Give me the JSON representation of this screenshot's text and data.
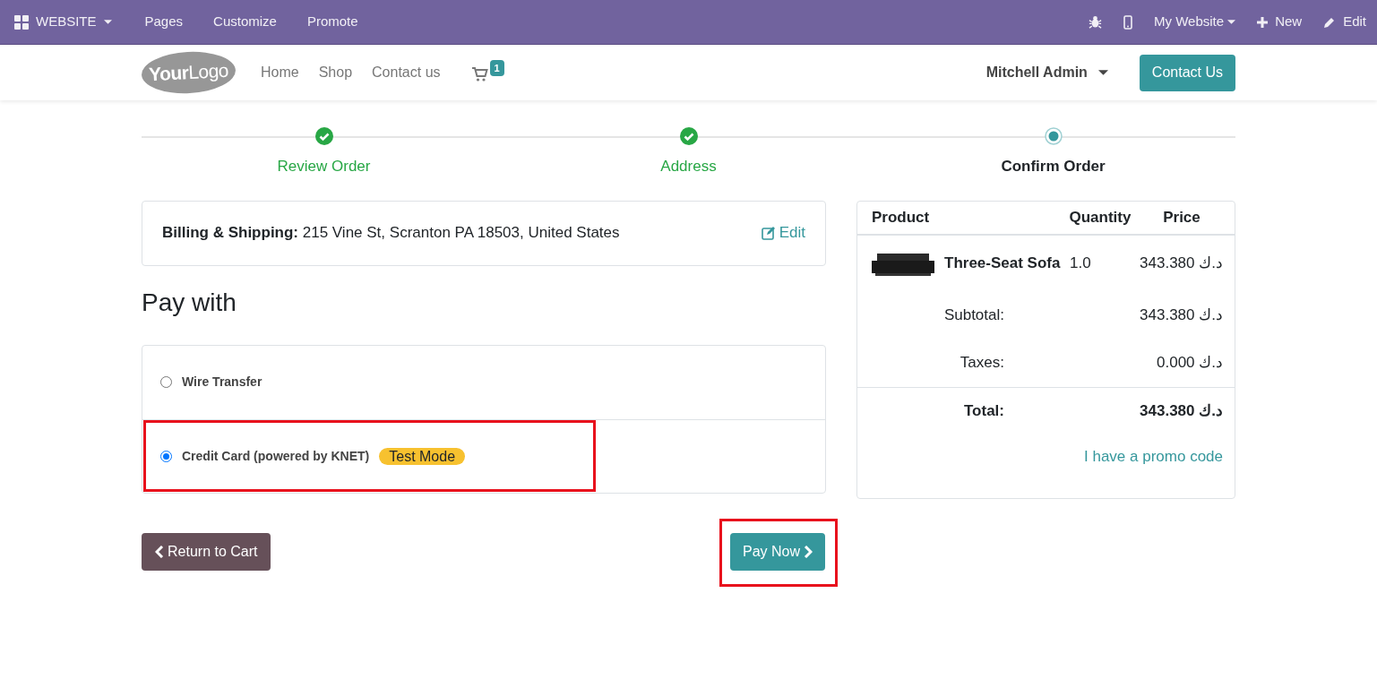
{
  "top_bar": {
    "app_menu": "WEBSITE",
    "left_items": [
      "Pages",
      "Customize",
      "Promote"
    ],
    "website_menu": "My Website",
    "new_button": "New",
    "edit_button": "Edit"
  },
  "navbar": {
    "logo": {
      "bold": "Your",
      "light": "Logo"
    },
    "links": [
      "Home",
      "Shop",
      "Contact us"
    ],
    "cart_count": "1",
    "user_menu": "Mitchell Admin",
    "contact_button": "Contact Us"
  },
  "steps": [
    {
      "label": "Review Order",
      "done": true,
      "selected": false
    },
    {
      "label": "Address",
      "done": true,
      "selected": false
    },
    {
      "label": "Confirm Order",
      "done": false,
      "selected": true
    }
  ],
  "billing": {
    "label": "Billing & Shipping:",
    "address": "215 Vine St, Scranton PA 18503, United States",
    "edit_link": "Edit"
  },
  "pay_with": {
    "title": "Pay with",
    "methods": [
      {
        "label": "Wire Transfer",
        "selected": false,
        "highlighted": false
      },
      {
        "label": "Credit Card (powered by KNET)",
        "badge": "Test Mode",
        "selected": true,
        "highlighted": true
      }
    ]
  },
  "buttons": {
    "return": "Return to Cart",
    "pay": {
      "label": "Pay Now",
      "highlighted": true
    }
  },
  "summary": {
    "columns": [
      "Product",
      "Quantity",
      "Price"
    ],
    "rows": [
      {
        "product": "Three-Seat Sofa",
        "quantity": "1.0",
        "price": "343.380 د.ك"
      }
    ],
    "totals": [
      {
        "label": "Subtotal:",
        "value": "343.380 د.ك",
        "kind": "line"
      },
      {
        "label": "Taxes:",
        "value": "0.000 د.ك",
        "kind": "line"
      },
      {
        "label": "Total:",
        "value": "343.380 د.ك",
        "kind": "grand"
      }
    ],
    "promo_link": "I have a promo code"
  }
}
